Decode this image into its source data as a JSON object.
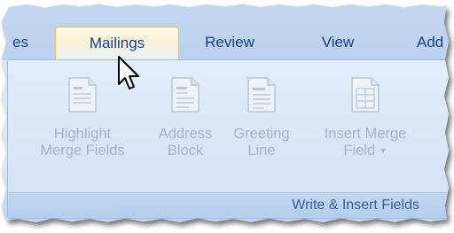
{
  "tabs": [
    {
      "label": "es",
      "active": false
    },
    {
      "label": "Mailings",
      "active": true
    },
    {
      "label": "Review",
      "active": false
    },
    {
      "label": "View",
      "active": false
    },
    {
      "label": "Add",
      "active": false
    }
  ],
  "group": {
    "label": "Write & Insert Fields",
    "commands": [
      {
        "line1": "Highlight",
        "line2": "Merge Fields",
        "icon": "document-icon",
        "enabled": false
      },
      {
        "line1": "Address",
        "line2": "Block",
        "icon": "document-icon",
        "enabled": false
      },
      {
        "line1": "Greeting",
        "line2": "Line",
        "icon": "document-icon",
        "enabled": false
      },
      {
        "line1": "Insert Merge",
        "line2": "Field",
        "icon": "table-document-icon",
        "enabled": false,
        "dropdown": true
      }
    ]
  },
  "colors": {
    "tab_text": "#15428b",
    "disabled_text": "#a4b3c7",
    "active_tab_border": "#f1c15f",
    "group_label": "#3b5d92"
  },
  "dropdown_glyph": "▼"
}
